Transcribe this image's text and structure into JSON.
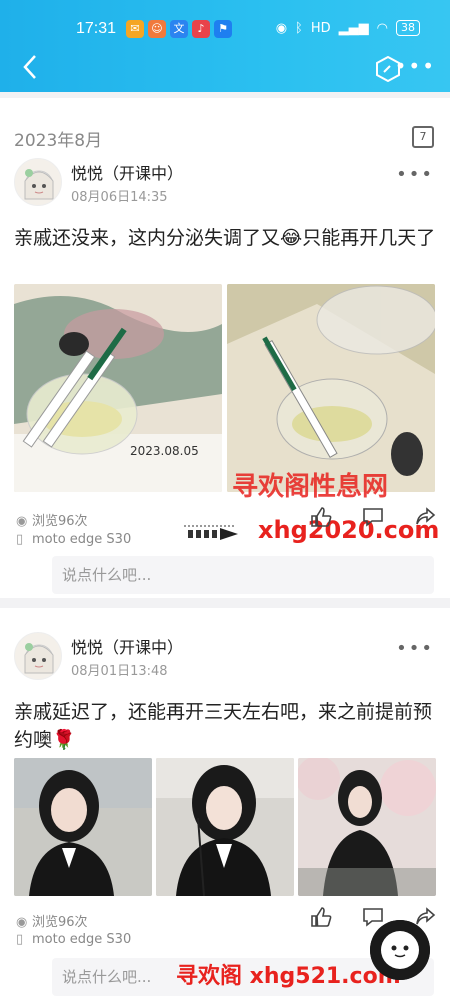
{
  "status_bar": {
    "time": "17:31",
    "battery": "38",
    "apps": [
      {
        "icon": "app-icon-1",
        "color": "#f5a623"
      },
      {
        "icon": "app-icon-2",
        "color": "#f07a3c"
      },
      {
        "icon": "app-icon-3",
        "color": "#2b84f0"
      },
      {
        "icon": "app-icon-4",
        "color": "#e8434b"
      },
      {
        "icon": "app-icon-5",
        "color": "#1e7ff0"
      }
    ]
  },
  "header": {
    "back_icon": "back-arrow-icon",
    "action_icon": "hexagon-icon",
    "more_icon": "more-icon"
  },
  "month_label": "2023年8月",
  "calendar_day": "7",
  "posts": [
    {
      "author": "悦悦（开课中）",
      "date": "08月06日14:35",
      "text": "亲戚还没来，这内分泌失调了又😂只能再开几天了",
      "photo_date": "2023.08.05",
      "views": "浏览96次",
      "device": "moto edge S30",
      "comment_placeholder": "说点什么吧..."
    },
    {
      "author": "悦悦（开课中）",
      "date": "08月01日13:48",
      "text": "亲戚延迟了，还能再开三天左右吧，来之前提前预约噢🌹",
      "views": "浏览96次",
      "device": "moto edge S30",
      "comment_placeholder": "说点什么吧..."
    }
  ],
  "watermarks": {
    "site_name": "寻欢阁性息网",
    "domain_1": "xhg2020.com",
    "domain_2": "寻欢阁 xhg521.com"
  },
  "colors": {
    "header": "#27b8ee",
    "accent_red": "#e8221e"
  }
}
